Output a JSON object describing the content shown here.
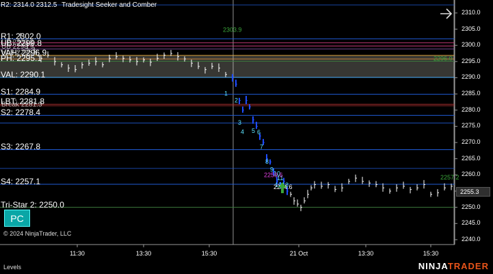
{
  "chart": {
    "title_overlay": "R2: 2314.0  2312.5",
    "title_partial": "Tradesight Seeker and Comber",
    "copyright": "© 2024 NinjaTrader, LLC",
    "panel_tab": "Levels",
    "pc_button": "PC",
    "last_price": "2255.3",
    "brand_left": "NINJA",
    "brand_right": "TRADER",
    "price_axis_ticks": [
      "2310.0",
      "2305.0",
      "2300.0",
      "2295.0",
      "2290.0",
      "2285.0",
      "2280.0",
      "2275.0",
      "2270.0",
      "2265.0",
      "2260.0",
      "2255.0",
      "2250.0",
      "2245.0",
      "2240.0"
    ],
    "time_axis_ticks": [
      "11:30",
      "13:30",
      "15:30",
      "21 Oct",
      "13:30",
      "15:30"
    ],
    "levels": [
      {
        "label": "R1: 2302.0",
        "price": 2302.0,
        "color": "#1f5bd6"
      },
      {
        "label": "UB: 2299.8",
        "price": 2299.8,
        "color": "#c83a7a"
      },
      {
        "label": "VAH: 2296.9",
        "price": 2296.9,
        "color": "#d9a13a"
      },
      {
        "label": "PH: 2295.1",
        "price": 2295.1,
        "color": "#3d7a3d"
      },
      {
        "label": "VAL: 2290.1",
        "price": 2290.1,
        "color": "#48b0ff"
      },
      {
        "label": "S1: 2284.9",
        "price": 2284.9,
        "color": "#1f5bd6"
      },
      {
        "label": "LBT: 2281.8",
        "price": 2281.8,
        "color": "#b03030"
      },
      {
        "label": "S2: 2278.4",
        "price": 2278.4,
        "color": "#1f5bd6"
      },
      {
        "label": "S3: 2267.8",
        "price": 2267.8,
        "color": "#1f5bd6"
      },
      {
        "label": "S4: 2257.1",
        "price": 2257.1,
        "color": "#1f5bd6"
      },
      {
        "label": "Tri-Star 2: 2250.0",
        "price": 2250.0,
        "color": "#3d7a3d"
      }
    ],
    "overlap_labels": [
      "UP 2300.8",
      "UB 2298.9",
      "HLB 2295.8",
      "Break 2281.3"
    ],
    "annotations": [
      "2303.9",
      "2296.0",
      "2259.6",
      "2257.2",
      "2254.6"
    ],
    "count_labels": [
      "1",
      "2",
      "3",
      "4",
      "5",
      "6",
      "7",
      "8",
      "9",
      "10",
      "11",
      "12",
      "13"
    ]
  }
}
